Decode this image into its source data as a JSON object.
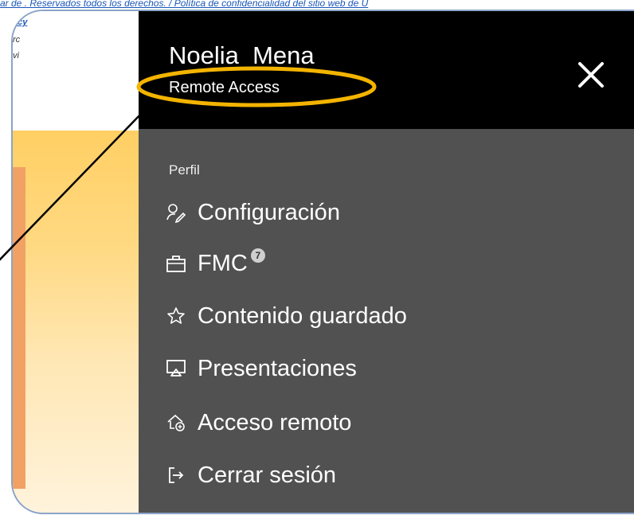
{
  "background": {
    "top_line": "ar de . Reservados todos los derechos. / Política de confidencialidad del sitio web de U",
    "left_link": "acy",
    "left_frag_1": "rc",
    "left_frag_2": "vi"
  },
  "panel": {
    "user_name": "Noelia  Mena",
    "subtitle": "Remote Access",
    "section_label": "Perfil",
    "items": [
      {
        "label": "Configuración",
        "icon": "user-edit-icon"
      },
      {
        "label": "FMC",
        "icon": "briefcase-icon",
        "badge": "7"
      },
      {
        "label": "Contenido guardado",
        "icon": "star-icon"
      },
      {
        "label": "Presentaciones",
        "icon": "presentation-icon"
      },
      {
        "label": "Acceso remoto",
        "icon": "remote-home-icon"
      },
      {
        "label": "Cerrar sesión",
        "icon": "logout-icon"
      }
    ]
  },
  "colors": {
    "panel_bg": "#515151",
    "header_bg": "#000000",
    "highlight": "#f3b400",
    "hero_gradient": "#ffcf63",
    "link": "#1a56b8"
  }
}
